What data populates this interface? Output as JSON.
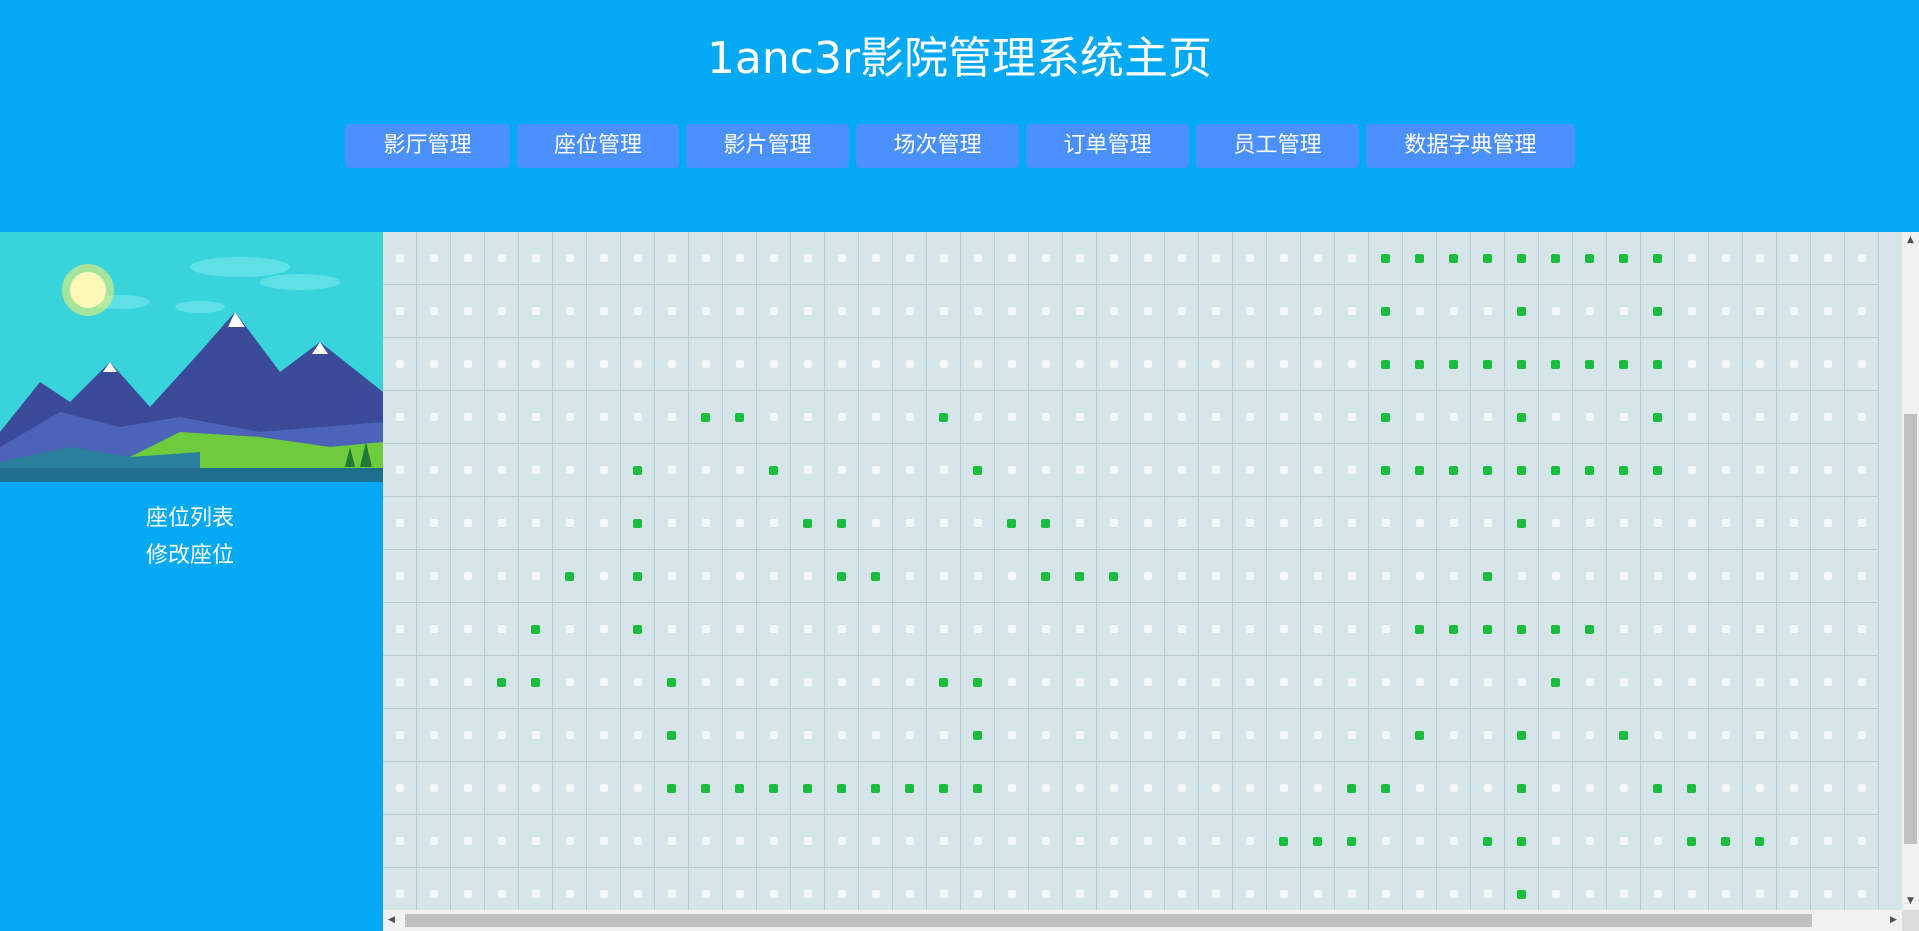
{
  "header": {
    "title": "1anc3r影院管理系统主页"
  },
  "nav": [
    {
      "label": "影厅管理",
      "width": 165
    },
    {
      "label": "座位管理",
      "width": 162
    },
    {
      "label": "影片管理",
      "width": 163
    },
    {
      "label": "场次管理",
      "width": 163
    },
    {
      "label": "订单管理",
      "width": 163
    },
    {
      "label": "员工管理",
      "width": 163
    },
    {
      "label": "数据字典管理",
      "width": 209
    }
  ],
  "sidebar": {
    "links": [
      "座位列表",
      "修改座位"
    ]
  },
  "seat_grid": {
    "rows": 13,
    "cols": 44,
    "selected": [
      [
        0,
        29
      ],
      [
        0,
        30
      ],
      [
        0,
        31
      ],
      [
        0,
        32
      ],
      [
        0,
        33
      ],
      [
        0,
        34
      ],
      [
        0,
        35
      ],
      [
        0,
        36
      ],
      [
        0,
        37
      ],
      [
        1,
        29
      ],
      [
        1,
        33
      ],
      [
        1,
        37
      ],
      [
        2,
        29
      ],
      [
        2,
        30
      ],
      [
        2,
        31
      ],
      [
        2,
        32
      ],
      [
        2,
        33
      ],
      [
        2,
        34
      ],
      [
        2,
        35
      ],
      [
        2,
        36
      ],
      [
        2,
        37
      ],
      [
        3,
        9
      ],
      [
        3,
        10
      ],
      [
        3,
        16
      ],
      [
        3,
        29
      ],
      [
        3,
        33
      ],
      [
        3,
        37
      ],
      [
        4,
        7
      ],
      [
        4,
        11
      ],
      [
        4,
        17
      ],
      [
        4,
        29
      ],
      [
        4,
        30
      ],
      [
        4,
        31
      ],
      [
        4,
        32
      ],
      [
        4,
        33
      ],
      [
        4,
        34
      ],
      [
        4,
        35
      ],
      [
        4,
        36
      ],
      [
        4,
        37
      ],
      [
        5,
        7
      ],
      [
        5,
        12
      ],
      [
        5,
        13
      ],
      [
        5,
        18
      ],
      [
        5,
        19
      ],
      [
        5,
        33
      ],
      [
        6,
        5
      ],
      [
        6,
        7
      ],
      [
        6,
        13
      ],
      [
        6,
        14
      ],
      [
        6,
        19
      ],
      [
        6,
        20
      ],
      [
        6,
        21
      ],
      [
        6,
        32
      ],
      [
        7,
        4
      ],
      [
        7,
        7
      ],
      [
        7,
        30
      ],
      [
        7,
        31
      ],
      [
        7,
        32
      ],
      [
        7,
        33
      ],
      [
        7,
        34
      ],
      [
        7,
        35
      ],
      [
        8,
        3
      ],
      [
        8,
        4
      ],
      [
        8,
        8
      ],
      [
        8,
        16
      ],
      [
        8,
        17
      ],
      [
        8,
        34
      ],
      [
        9,
        8
      ],
      [
        9,
        17
      ],
      [
        9,
        30
      ],
      [
        9,
        33
      ],
      [
        9,
        36
      ],
      [
        10,
        8
      ],
      [
        10,
        9
      ],
      [
        10,
        10
      ],
      [
        10,
        11
      ],
      [
        10,
        12
      ],
      [
        10,
        13
      ],
      [
        10,
        14
      ],
      [
        10,
        15
      ],
      [
        10,
        16
      ],
      [
        10,
        17
      ],
      [
        10,
        28
      ],
      [
        10,
        29
      ],
      [
        10,
        33
      ],
      [
        10,
        37
      ],
      [
        10,
        38
      ],
      [
        11,
        26
      ],
      [
        11,
        27
      ],
      [
        11,
        28
      ],
      [
        11,
        32
      ],
      [
        11,
        33
      ],
      [
        11,
        38
      ],
      [
        11,
        39
      ],
      [
        11,
        40
      ],
      [
        12,
        33
      ]
    ]
  },
  "colors": {
    "background": "#03a9f4",
    "nav_button": "#4a90ff",
    "grid_bg": "#d6e5e8",
    "seat_selected": "#1cbd3e",
    "seat_empty": "#f4f8f9"
  }
}
